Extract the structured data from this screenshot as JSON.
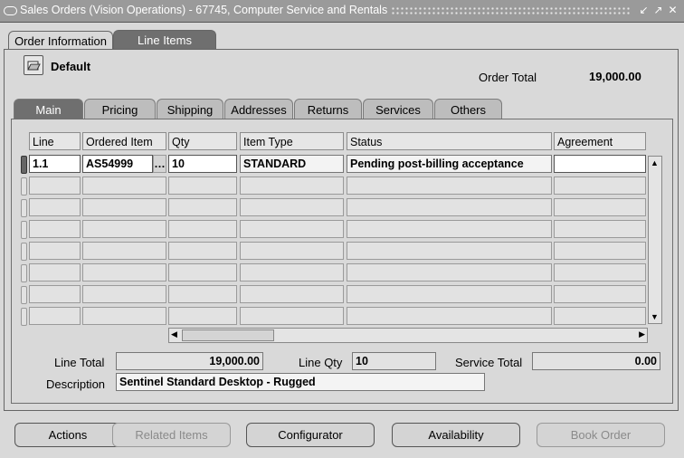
{
  "window": {
    "title": "Sales Orders (Vision Operations) - 67745, Computer Service and Rentals"
  },
  "top_tabs": [
    {
      "label": "Order Information",
      "active": false
    },
    {
      "label": "Line Items",
      "active": true
    }
  ],
  "folder": {
    "label": "Default"
  },
  "order_total": {
    "label": "Order Total",
    "value": "19,000.00"
  },
  "sub_tabs": [
    {
      "label": "Main",
      "active": true
    },
    {
      "label": "Pricing"
    },
    {
      "label": "Shipping"
    },
    {
      "label": "Addresses"
    },
    {
      "label": "Returns"
    },
    {
      "label": "Services"
    },
    {
      "label": "Others"
    }
  ],
  "grid": {
    "columns": [
      "Line",
      "Ordered Item",
      "Qty",
      "Item Type",
      "Status",
      "Agreement"
    ],
    "rows": [
      {
        "line": "1.1",
        "ordered_item": "AS54999",
        "qty": "10",
        "item_type": "STANDARD",
        "status": "Pending post-billing acceptance",
        "agreement": ""
      }
    ]
  },
  "summary": {
    "line_total_label": "Line Total",
    "line_total": "19,000.00",
    "line_qty_label": "Line Qty",
    "line_qty": "10",
    "service_total_label": "Service Total",
    "service_total": "0.00",
    "description_label": "Description",
    "description": "Sentinel Standard Desktop - Rugged"
  },
  "buttons": {
    "actions": "Actions",
    "related_items": "Related Items",
    "configurator": "Configurator",
    "availability": "Availability",
    "book_order": "Book Order"
  },
  "icons": {
    "folder": "folder-open-icon",
    "window": "window-icon"
  }
}
